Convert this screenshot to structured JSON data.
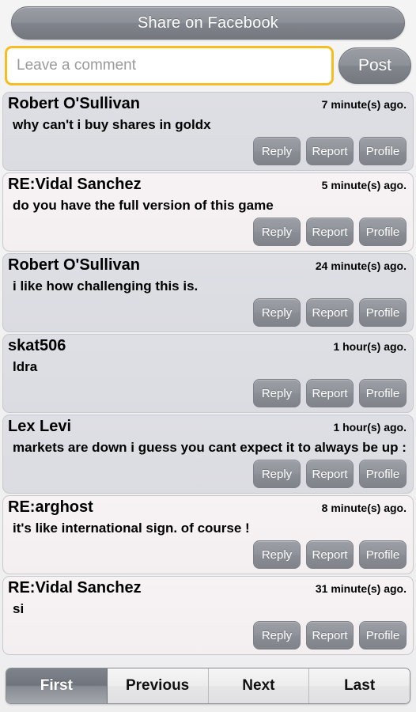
{
  "share": {
    "label": "Share on Facebook"
  },
  "composer": {
    "placeholder": "Leave a comment",
    "value": "",
    "post_label": "Post"
  },
  "actions": {
    "reply": "Reply",
    "report": "Report",
    "profile": "Profile"
  },
  "comments": [
    {
      "author": "Robert O'Sullivan",
      "timestamp": "7 minute(s) ago.",
      "text": "why can't i buy shares in goldx",
      "is_reply": false
    },
    {
      "author": "RE:Vidal Sanchez",
      "timestamp": "5 minute(s) ago.",
      "text": "do you have the full version of this game",
      "is_reply": true
    },
    {
      "author": "Robert O'Sullivan",
      "timestamp": "24 minute(s) ago.",
      "text": "i like how challenging this is.",
      "is_reply": false
    },
    {
      "author": "skat506",
      "timestamp": "1 hour(s) ago.",
      "text": "ldra",
      "is_reply": false
    },
    {
      "author": "Lex Levi",
      "timestamp": "1 hour(s) ago.",
      "text": "markets are down i guess you cant expect it to always be up :(",
      "is_reply": false
    },
    {
      "author": "RE:arghost",
      "timestamp": "8 minute(s) ago.",
      "text": "it's like international sign. of course !",
      "is_reply": true
    },
    {
      "author": "RE:Vidal Sanchez",
      "timestamp": "31 minute(s) ago.",
      "text": "si",
      "is_reply": true
    }
  ],
  "pager": {
    "items": [
      {
        "label": "First",
        "active": true
      },
      {
        "label": "Previous",
        "active": false
      },
      {
        "label": "Next",
        "active": false
      },
      {
        "label": "Last",
        "active": false
      }
    ]
  },
  "colors": {
    "accent_focus": "#f5bd20",
    "button_gray": "#8c9097",
    "card_normal": "#dedfe4",
    "card_reply": "#f7f3f5"
  }
}
